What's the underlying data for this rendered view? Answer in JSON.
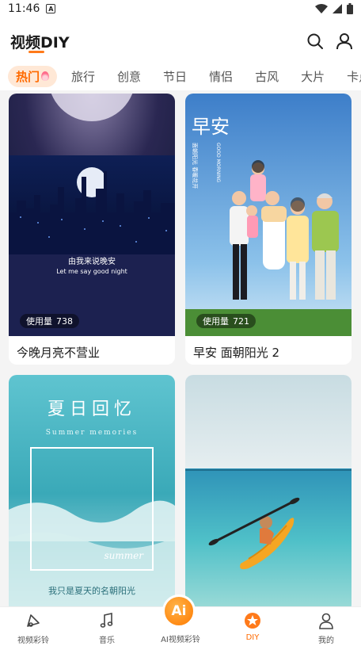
{
  "status_bar": {
    "time": "11:46",
    "notif_glyph": "A"
  },
  "header": {
    "title": "视频DIY",
    "icons": [
      "search-icon",
      "user-icon"
    ]
  },
  "tabs": [
    {
      "label": "热门",
      "active": true
    },
    {
      "label": "旅行"
    },
    {
      "label": "创意"
    },
    {
      "label": "节日"
    },
    {
      "label": "情侣"
    },
    {
      "label": "古风"
    },
    {
      "label": "大片"
    },
    {
      "label": "卡点"
    }
  ],
  "cards": [
    {
      "title": "今晚月亮不营业",
      "usage_label": "使用量",
      "usage_count": "738",
      "caption_cn": "由我来说晚安",
      "caption_en": "Let me say good night"
    },
    {
      "title": "早安 面朝阳光 2",
      "usage_label": "使用量",
      "usage_count": "721",
      "big_text": "早安",
      "side_text": "面朝阳光 春暖花开",
      "en_text": "GOOD MORNING"
    },
    {
      "title_text": "夏日回忆",
      "subtitle": "Summer memories",
      "corner": "summer",
      "bottom_text": "我只是夏天的名朝阳光"
    },
    {}
  ],
  "bottom_nav": [
    {
      "label": "视频彩铃",
      "icon": "ringtone-icon"
    },
    {
      "label": "音乐",
      "icon": "music-note-icon"
    },
    {
      "label": "AI视频彩铃",
      "icon": "ai-icon",
      "ai_glyph": "Ai"
    },
    {
      "label": "DIY",
      "icon": "diy-star-icon",
      "active": true
    },
    {
      "label": "我的",
      "icon": "profile-icon"
    }
  ],
  "colors": {
    "accent": "#ff6a00",
    "tab_active_bg": "#ffe8d6"
  }
}
